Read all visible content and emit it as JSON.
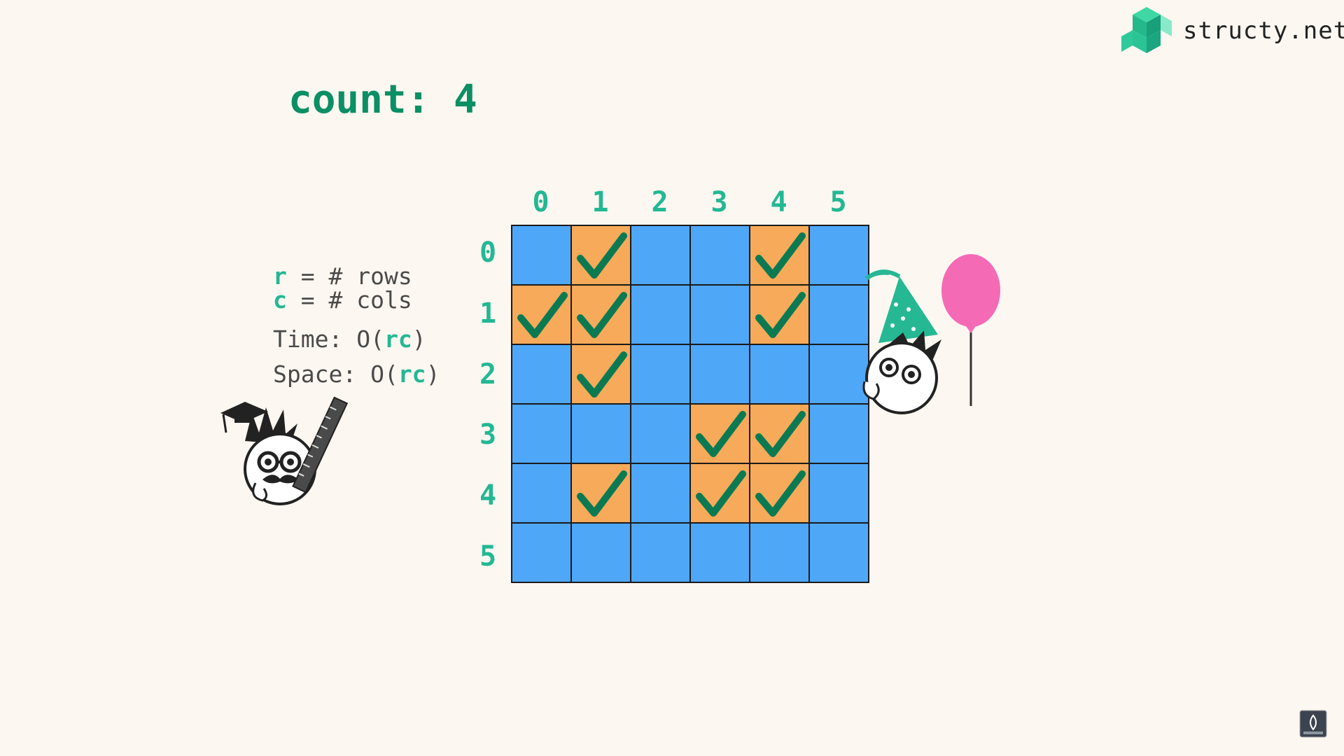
{
  "brand": {
    "text": "structy.net",
    "logo_icon": "structy-logo-icon"
  },
  "count": {
    "label": "count:",
    "value": "4"
  },
  "notes": {
    "r_var": "r",
    "r_desc": " = # rows",
    "c_var": "c",
    "c_desc": " = # cols",
    "time_prefix": "Time: O(",
    "time_var": "rc",
    "time_suffix": ")",
    "space_prefix": "Space: O(",
    "space_var": "rc",
    "space_suffix": ")"
  },
  "grid": {
    "col_labels": [
      "0",
      "1",
      "2",
      "3",
      "4",
      "5"
    ],
    "row_labels": [
      "0",
      "1",
      "2",
      "3",
      "4",
      "5"
    ],
    "cells": [
      [
        "W",
        "L",
        "W",
        "W",
        "L",
        "W"
      ],
      [
        "L",
        "L",
        "W",
        "W",
        "L",
        "W"
      ],
      [
        "W",
        "L",
        "W",
        "W",
        "W",
        "W"
      ],
      [
        "W",
        "W",
        "W",
        "L",
        "L",
        "W"
      ],
      [
        "W",
        "L",
        "W",
        "L",
        "L",
        "W"
      ],
      [
        "W",
        "W",
        "W",
        "W",
        "W",
        "W"
      ]
    ],
    "legend_colors": {
      "water": "#4fa7f8",
      "land_visited": "#f7aa59",
      "check": "#0b7a52"
    }
  },
  "decor": {
    "teacher_icon": "professor-with-ruler-icon",
    "party_icon": "party-hat-and-balloon-icon",
    "badge_icon": "subscribe-badge-icon"
  }
}
